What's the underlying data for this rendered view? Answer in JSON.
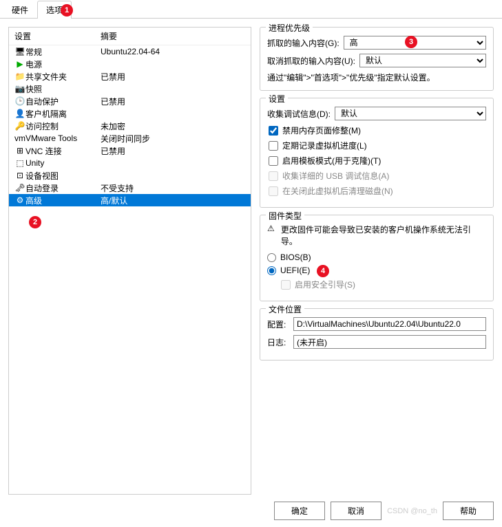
{
  "tabs": {
    "hardware": "硬件",
    "options": "选项"
  },
  "list": {
    "header_setting": "设置",
    "header_summary": "摘要",
    "rows": [
      {
        "name": "常规",
        "summary": "Ubuntu22.04-64",
        "icon": "monitor"
      },
      {
        "name": "电源",
        "summary": "",
        "icon": "play"
      },
      {
        "name": "共享文件夹",
        "summary": "已禁用",
        "icon": "folder"
      },
      {
        "name": "快照",
        "summary": "",
        "icon": "camera"
      },
      {
        "name": "自动保护",
        "summary": "已禁用",
        "icon": "clock"
      },
      {
        "name": "客户机隔离",
        "summary": "",
        "icon": "shield"
      },
      {
        "name": "访问控制",
        "summary": "未加密",
        "icon": "lock"
      },
      {
        "name": "VMware Tools",
        "summary": "关闭时间同步",
        "icon": "vm"
      },
      {
        "name": "VNC 连接",
        "summary": "已禁用",
        "icon": "vnc"
      },
      {
        "name": "Unity",
        "summary": "",
        "icon": "unity"
      },
      {
        "name": "设备视图",
        "summary": "",
        "icon": "device"
      },
      {
        "name": "自动登录",
        "summary": "不受支持",
        "icon": "key"
      },
      {
        "name": "高级",
        "summary": "高/默认",
        "icon": "adv"
      }
    ]
  },
  "priority": {
    "title": "进程优先级",
    "grabbed_label": "抓取的输入内容(G):",
    "grabbed_value": "高",
    "ungrabbed_label": "取消抓取的输入内容(U):",
    "ungrabbed_value": "默认",
    "hint": "通过\"编辑\">\"首选项\">\"优先级\"指定默认设置。"
  },
  "settings": {
    "title": "设置",
    "debug_label": "收集调试信息(D):",
    "debug_value": "默认",
    "cb_mem": "禁用内存页面修整(M)",
    "cb_log": "定期记录虚拟机进度(L)",
    "cb_template": "启用模板模式(用于克隆)(T)",
    "cb_usb": "收集详细的 USB 调试信息(A)",
    "cb_clean": "在关闭此虚拟机后清理磁盘(N)"
  },
  "firmware": {
    "title": "固件类型",
    "warning": "更改固件可能会导致已安装的客户机操作系统无法引导。",
    "bios": "BIOS(B)",
    "uefi": "UEFI(E)",
    "secureboot": "启用安全引导(S)"
  },
  "filelocation": {
    "title": "文件位置",
    "config_label": "配置:",
    "config_value": "D:\\VirtualMachines\\Ubuntu22.04\\Ubuntu22.0",
    "log_label": "日志:",
    "log_value": "(未开启)"
  },
  "footer": {
    "ok": "确定",
    "cancel": "取消",
    "help": "帮助"
  },
  "badges": {
    "b1": "1",
    "b2": "2",
    "b3": "3",
    "b4": "4"
  },
  "watermark": "CSDN @no_th"
}
